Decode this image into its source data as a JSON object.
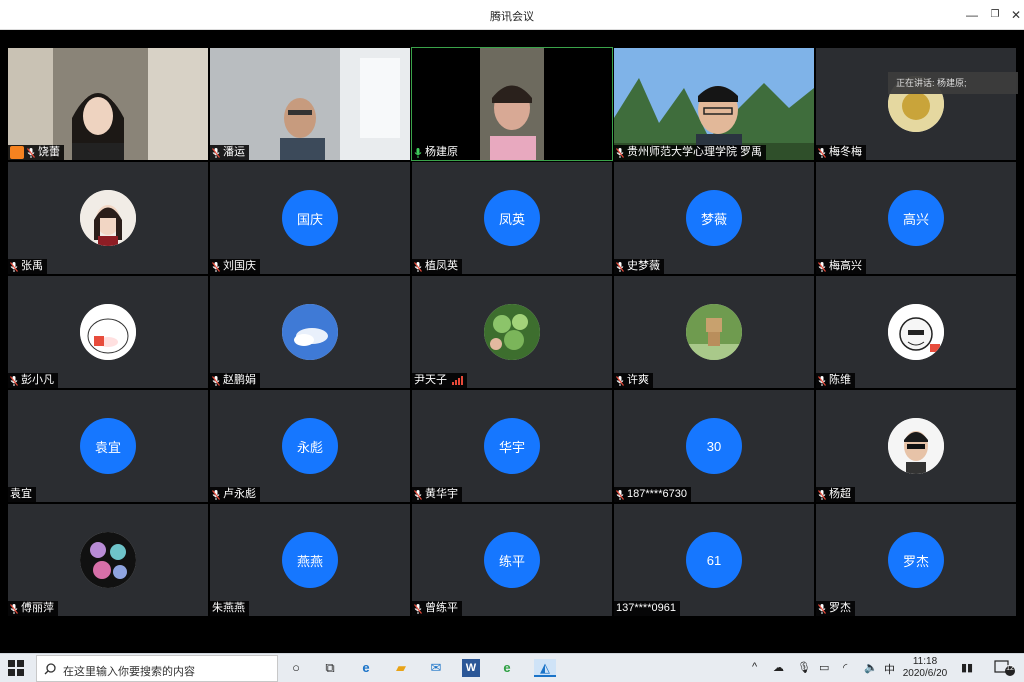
{
  "window": {
    "title": "腾讯会议"
  },
  "speaking": {
    "label": "正在讲话: 杨建原;"
  },
  "participants": [
    {
      "name": "饶蕾",
      "type": "video",
      "host": true
    },
    {
      "name": "潘运",
      "type": "video"
    },
    {
      "name": "杨建原",
      "type": "video",
      "active": true
    },
    {
      "name": "贵州师范大学心理学院 罗禹",
      "type": "video"
    },
    {
      "name": "梅冬梅",
      "type": "photo",
      "icon": "avatar-photo"
    },
    {
      "name": "张禹",
      "type": "photo",
      "icon": "avatar-photo"
    },
    {
      "name": "刘国庆",
      "type": "initials",
      "avatar": "国庆"
    },
    {
      "name": "植凤英",
      "type": "initials",
      "avatar": "凤英"
    },
    {
      "name": "史梦薇",
      "type": "initials",
      "avatar": "梦薇"
    },
    {
      "name": "梅高兴",
      "type": "initials",
      "avatar": "高兴"
    },
    {
      "name": "彭小凡",
      "type": "photo",
      "icon": "avatar-photo"
    },
    {
      "name": "赵鹏娟",
      "type": "photo",
      "icon": "avatar-photo"
    },
    {
      "name": "尹天子",
      "type": "photo",
      "icon": "avatar-photo",
      "nomic": true,
      "signal": true
    },
    {
      "name": "许爽",
      "type": "photo",
      "icon": "avatar-photo"
    },
    {
      "name": "陈维",
      "type": "photo",
      "icon": "avatar-photo"
    },
    {
      "name": "袁宜",
      "type": "initials",
      "avatar": "袁宜",
      "nomic": true
    },
    {
      "name": "卢永彪",
      "type": "initials",
      "avatar": "永彪"
    },
    {
      "name": "黄华宇",
      "type": "initials",
      "avatar": "华宇"
    },
    {
      "name": "187****6730",
      "type": "initials",
      "avatar": "30"
    },
    {
      "name": "杨超",
      "type": "photo",
      "icon": "avatar-photo"
    },
    {
      "name": "傅丽萍",
      "type": "photo",
      "icon": "avatar-photo"
    },
    {
      "name": "朱燕燕",
      "type": "initials",
      "avatar": "燕燕",
      "nomic": true
    },
    {
      "name": "曾练平",
      "type": "initials",
      "avatar": "练平"
    },
    {
      "name": "137****0961",
      "type": "initials",
      "avatar": "61",
      "nomic": true
    },
    {
      "name": "罗杰",
      "type": "initials",
      "avatar": "罗杰"
    }
  ],
  "taskbar": {
    "search_placeholder": "在这里输入你要搜索的内容",
    "ime": "中",
    "time": "11:18",
    "date": "2020/6/20",
    "notifications": "12"
  },
  "colors": {
    "avatar_blue": "#1677ff",
    "tile_bg": "#2b2d31",
    "active_border": "#3aa34a"
  }
}
